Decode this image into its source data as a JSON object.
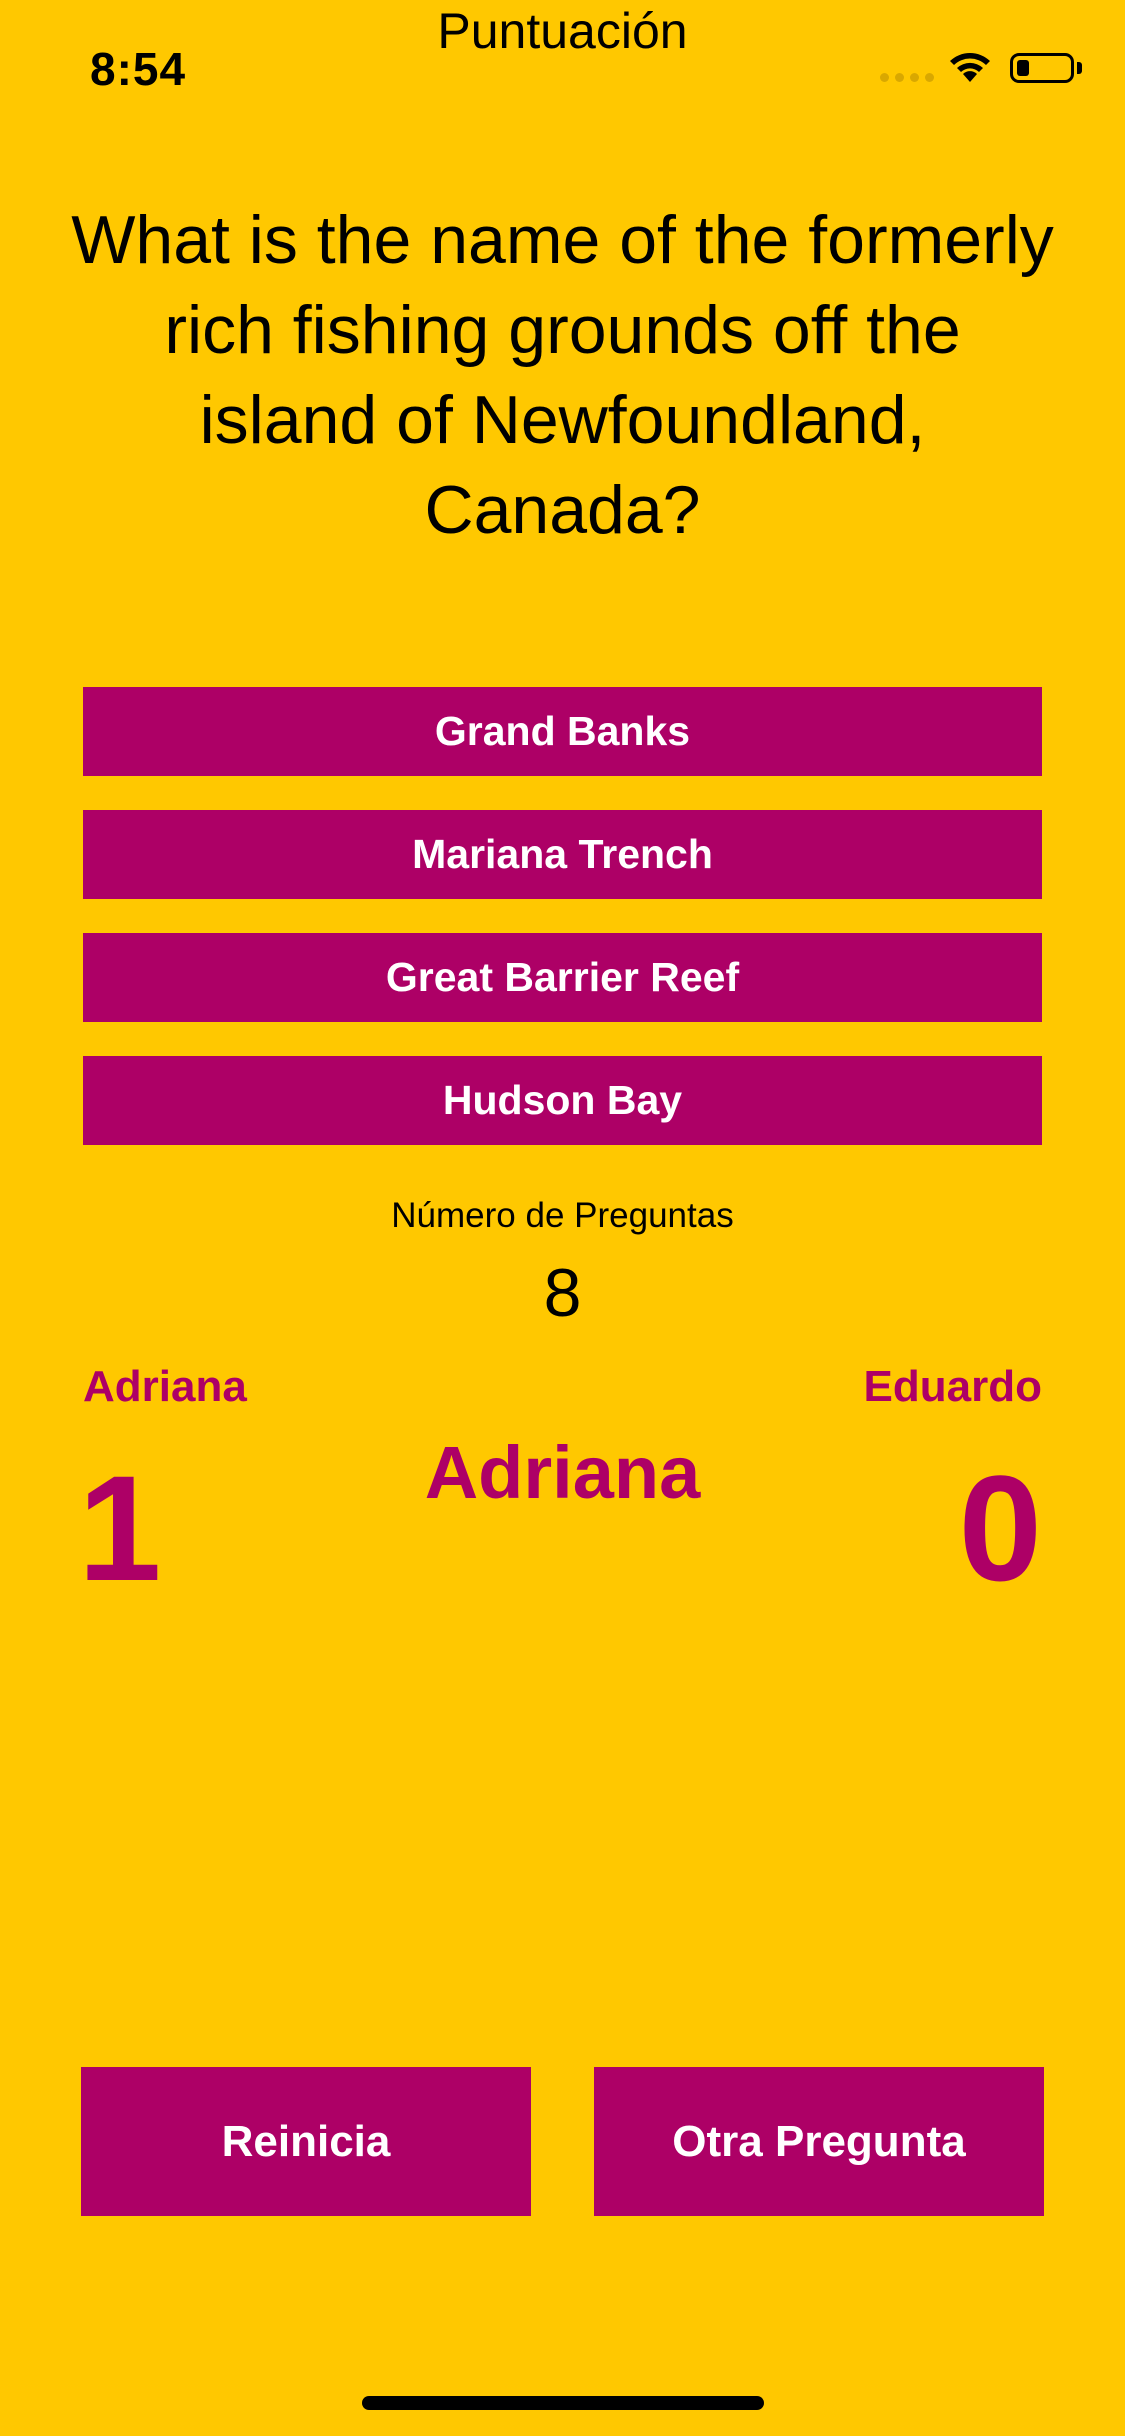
{
  "status_bar": {
    "time": "8:54"
  },
  "screen": {
    "title": "Puntuación"
  },
  "question": {
    "text": "What is the name of the formerly rich fishing grounds off the island of Newfoundland, Canada?"
  },
  "answers": [
    {
      "label": "Grand Banks"
    },
    {
      "label": "Mariana Trench"
    },
    {
      "label": "Great Barrier Reef"
    },
    {
      "label": "Hudson Bay"
    }
  ],
  "question_count": {
    "label": "Número de Preguntas",
    "value": "8"
  },
  "players": {
    "left": {
      "name": "Adriana",
      "score": "1"
    },
    "right": {
      "name": "Eduardo",
      "score": "0"
    },
    "current": "Adriana"
  },
  "buttons": {
    "restart": "Reinicia",
    "next": "Otra Pregunta"
  },
  "colors": {
    "background": "#FFC800",
    "accent": "#AD0066",
    "button_text": "#FFFFFF"
  },
  "icons": {
    "signal": "cellular-signal-icon",
    "wifi": "wifi-icon",
    "battery": "battery-icon"
  }
}
